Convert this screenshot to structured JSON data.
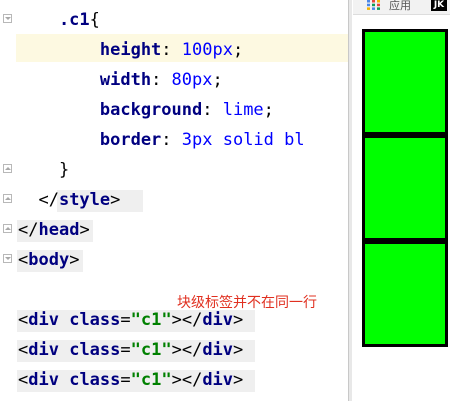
{
  "editor": {
    "lines": [
      {
        "parts": [
          {
            "t": "    .c1",
            "c": "sel"
          },
          {
            "t": "{",
            "c": "brace"
          }
        ]
      },
      {
        "parts": [
          {
            "t": "        height",
            "c": "prop"
          },
          {
            "t": ": ",
            "c": ""
          },
          {
            "t": "100px",
            "c": "num"
          },
          {
            "t": ";",
            "c": ""
          }
        ]
      },
      {
        "parts": [
          {
            "t": "        width",
            "c": "prop"
          },
          {
            "t": ": ",
            "c": ""
          },
          {
            "t": "80px",
            "c": "num"
          },
          {
            "t": ";",
            "c": ""
          }
        ]
      },
      {
        "parts": [
          {
            "t": "        background",
            "c": "prop"
          },
          {
            "t": ": ",
            "c": ""
          },
          {
            "t": "lime",
            "c": "num"
          },
          {
            "t": ";",
            "c": ""
          }
        ]
      },
      {
        "parts": [
          {
            "t": "        border",
            "c": "prop"
          },
          {
            "t": ": ",
            "c": ""
          },
          {
            "t": "3px solid bl",
            "c": "num"
          }
        ]
      },
      {
        "parts": [
          {
            "t": "    }",
            "c": "brace"
          }
        ]
      },
      {
        "parts": [
          {
            "t": "  </",
            "c": ""
          },
          {
            "t": "style",
            "c": "tag"
          },
          {
            "t": ">",
            "c": ""
          }
        ]
      },
      {
        "parts": [
          {
            "t": "</",
            "c": ""
          },
          {
            "t": "head",
            "c": "tag"
          },
          {
            "t": ">",
            "c": ""
          }
        ]
      },
      {
        "parts": [
          {
            "t": "<",
            "c": ""
          },
          {
            "t": "body",
            "c": "tag"
          },
          {
            "t": ">",
            "c": ""
          }
        ]
      },
      {
        "parts": []
      },
      {
        "parts": [
          {
            "t": "<",
            "c": ""
          },
          {
            "t": "div ",
            "c": "tag"
          },
          {
            "t": "class",
            "c": "tag"
          },
          {
            "t": "=",
            "c": ""
          },
          {
            "t": "\"c1\"",
            "c": "str"
          },
          {
            "t": "></",
            "c": ""
          },
          {
            "t": "div",
            "c": "tag"
          },
          {
            "t": ">",
            "c": ""
          }
        ]
      },
      {
        "parts": [
          {
            "t": "<",
            "c": ""
          },
          {
            "t": "div ",
            "c": "tag"
          },
          {
            "t": "class",
            "c": "tag"
          },
          {
            "t": "=",
            "c": ""
          },
          {
            "t": "\"c1\"",
            "c": "str"
          },
          {
            "t": "></",
            "c": ""
          },
          {
            "t": "div",
            "c": "tag"
          },
          {
            "t": ">",
            "c": ""
          }
        ]
      },
      {
        "parts": [
          {
            "t": "<",
            "c": ""
          },
          {
            "t": "div ",
            "c": "tag"
          },
          {
            "t": "class",
            "c": "tag"
          },
          {
            "t": "=",
            "c": ""
          },
          {
            "t": "\"c1\"",
            "c": "str"
          },
          {
            "t": "></",
            "c": ""
          },
          {
            "t": "div",
            "c": "tag"
          },
          {
            "t": ">",
            "c": ""
          }
        ]
      }
    ],
    "annotation": "块级标签并不在同一行"
  },
  "browser": {
    "bookmarks": {
      "apps_label": "应用",
      "apps_icon": "apps-grid-icon",
      "extension_label": "JK"
    },
    "boxes": [
      {
        "label": "",
        "color": "#00ff00"
      },
      {
        "label": "",
        "color": "#00ff00"
      },
      {
        "label": "",
        "color": "#00ff00"
      }
    ]
  },
  "colors": {
    "lime": "#00ff00",
    "annotation": "#e03020",
    "current_line": "#fdf9e1"
  }
}
